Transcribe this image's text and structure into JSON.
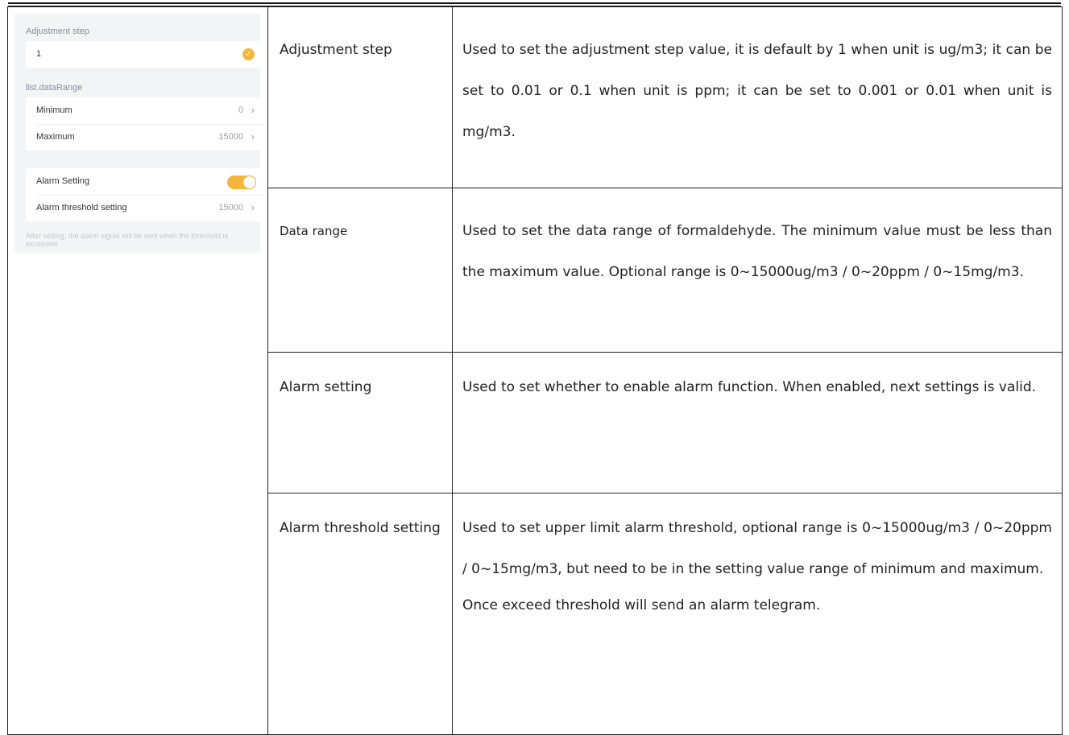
{
  "panel": {
    "adjustment_step": {
      "label": "Adjustment step",
      "value": "1"
    },
    "data_range": {
      "label": "list.dataRange",
      "minimum_label": "Minimum",
      "minimum_value": "0",
      "maximum_label": "Maximum",
      "maximum_value": "15000"
    },
    "alarm": {
      "setting_label": "Alarm Setting",
      "enabled": true,
      "threshold_label": "Alarm threshold setting",
      "threshold_value": "15000"
    },
    "hint": "After setting, the alarm signal will be sent when the threshold is exceeded.",
    "accent_color": "#f6b53c"
  },
  "table": {
    "rows": [
      {
        "name": "Adjustment step",
        "description": "Used to set the adjustment step value, it is default by 1 when unit is ug/m3; it can be set to 0.01 or 0.1 when unit is ppm; it can be set to 0.001 or 0.01 when unit is mg/m3."
      },
      {
        "name": "Data range",
        "description": "Used to set the data range of formaldehyde. The minimum value must be less than the maximum value. Optional range is 0~15000ug/m3 / 0~20ppm / 0~15mg/m3."
      },
      {
        "name": "Alarm setting",
        "description": "Used to set whether to enable alarm function. When enabled, next settings is valid."
      },
      {
        "name": "Alarm threshold setting",
        "description": "Used to set upper limit alarm threshold, optional range is 0~15000ug/m3 / 0~20ppm / 0~15mg/m3, but need to be in the setting value range of minimum and maximum.",
        "note": "Once exceed threshold will send an alarm telegram."
      }
    ]
  }
}
